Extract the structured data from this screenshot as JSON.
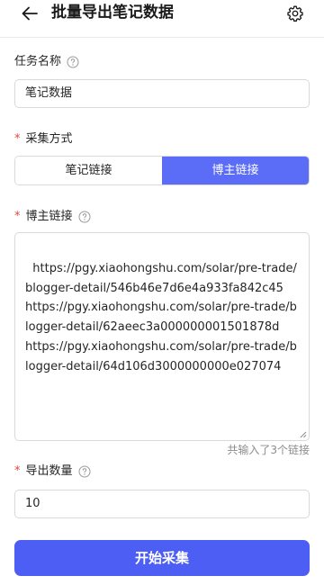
{
  "header": {
    "title": "批量导出笔记数据",
    "back_icon": "arrow-left-icon",
    "settings_icon": "gear-icon"
  },
  "form": {
    "task_name": {
      "label": "任务名称",
      "value": "笔记数据"
    },
    "collect_method": {
      "required_mark": "*",
      "label": "采集方式",
      "options": [
        "笔记链接",
        "博主链接"
      ],
      "selected": "博主链接"
    },
    "blogger_links": {
      "required_mark": "*",
      "label": "博主链接",
      "value": "https://pgy.xiaohongshu.com/solar/pre-trade/blogger-detail/546b46e7d6e4a933fa842c45\nhttps://pgy.xiaohongshu.com/solar/pre-trade/blogger-detail/62aeec3a000000001501878d\nhttps://pgy.xiaohongshu.com/solar/pre-trade/blogger-detail/64d106d3000000000e027074",
      "count_hint": "共输入了3个链接"
    },
    "export_count": {
      "required_mark": "*",
      "label": "导出数量",
      "value": "10"
    },
    "submit_label": "开始采集"
  },
  "colors": {
    "accent": "#4d5ef5",
    "required": "#e5483d"
  }
}
